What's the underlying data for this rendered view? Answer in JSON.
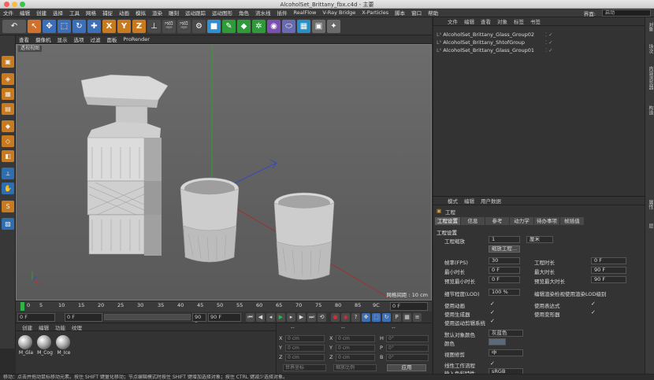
{
  "window": {
    "title": "AlcoholSet_Brittany_fbx.c4d - 主要"
  },
  "menubar": {
    "items": [
      "文件",
      "编辑",
      "创建",
      "选择",
      "工具",
      "网格",
      "捕捉",
      "动画",
      "模拟",
      "渲染",
      "雕刻",
      "运动跟踪",
      "运动图形",
      "角色",
      "流水线",
      "插件",
      "RealFlow",
      "V-Ray Bridge",
      "X-Particles",
      "脚本",
      "窗口",
      "帮助"
    ],
    "layout_label": "界面:",
    "layout_value": "启动"
  },
  "toolbar": {
    "axis_x": "X",
    "axis_y": "Y",
    "axis_z": "Z"
  },
  "viewport": {
    "menu": [
      "查看",
      "摄像机",
      "显示",
      "选项",
      "过滤",
      "面板",
      "ProRender"
    ],
    "label": "透视视图",
    "grid_label": "网格间距 : 10 cm"
  },
  "timeline": {
    "ticks": [
      "0",
      "5",
      "10",
      "15",
      "20",
      "25",
      "30",
      "35",
      "40",
      "45",
      "50",
      "55",
      "60",
      "65",
      "70",
      "75",
      "80",
      "85",
      "9C"
    ],
    "frame_display": "0 F"
  },
  "playbar": {
    "start": "0 F",
    "current": "0 F",
    "end_a": "90 F",
    "end_b": "90 F"
  },
  "materials": {
    "menu": [
      "创建",
      "编辑",
      "功能",
      "纹理"
    ],
    "items": [
      "M_Gla",
      "M_Cog",
      "M_Ice"
    ]
  },
  "coords": {
    "headers": [
      "--",
      "--",
      "--"
    ],
    "rows": [
      {
        "axis": "X",
        "pos": "0 cm",
        "axis2": "X",
        "size": "0 cm",
        "axis3": "H",
        "rot": "0°"
      },
      {
        "axis": "Y",
        "pos": "0 cm",
        "axis2": "Y",
        "size": "0 cm",
        "axis3": "P",
        "rot": "0°"
      },
      {
        "axis": "Z",
        "pos": "0 cm",
        "axis2": "Z",
        "size": "0 cm",
        "axis3": "B",
        "rot": "0°"
      }
    ],
    "mode1": "世界坐标",
    "mode2": "缩放比例",
    "apply": "应用"
  },
  "objects": {
    "menu": [
      "文件",
      "编辑",
      "查看",
      "对象",
      "标签",
      "书签"
    ],
    "items": [
      "AlcoholSet_Brittany_Glass_Group02",
      "AlcoholSet_Brittany_ShtofGroup",
      "AlcoholSet_Brittany_Glass_Group01"
    ]
  },
  "attributes": {
    "menu": [
      "模式",
      "编辑",
      "用户数据"
    ],
    "object_name": "工程",
    "tabs": [
      "工程设置",
      "信息",
      "参考",
      "动力学",
      "待办事项",
      "帧插值"
    ],
    "section": "工程设置",
    "scale_label": "工程缩放",
    "scale_value": "1",
    "scale_unit": "厘米",
    "scale_button": "缩放工程...",
    "fps_label": "帧率(FPS)",
    "fps_value": "30",
    "duration_label": "工程时长",
    "duration_value": "0 F",
    "min_time_label": "最小时长",
    "min_time_value": "0 F",
    "max_time_label": "最大时长",
    "max_time_value": "90 F",
    "preview_min_label": "预览最小时长",
    "preview_min_value": "0 F",
    "preview_max_label": "预览最大时长",
    "preview_max_value": "90 F",
    "lod_label": "细节程度(LOD)",
    "lod_value": "100 %",
    "lod_render_label": "编辑渲染检视使用渲染LOD级别",
    "use_anim": "使用动画",
    "use_expr": "使用表达式",
    "use_gen": "使用生成器",
    "use_deform": "使用变形器",
    "use_motion": "使用运动剪辑系统",
    "default_color_label": "默认对象颜色",
    "default_color_value": "灰蓝色",
    "color_label": "颜色",
    "view_clip_label": "视图修剪",
    "view_clip_value": "中",
    "linear_label": "线性工作流程",
    "input_color_label": "输入色彩特性",
    "input_color_value": "sRGB"
  },
  "right_tabs": [
    "对象",
    "场次",
    "内容浏览器",
    "构造",
    "属性",
    "层"
  ],
  "statusbar": {
    "text": "移动：点击并拖动鼠标移动元素。按住 SHIFT 键量化移动；节点编辑模式时按住 SHIFT 键增加选择对象；按住 CTRL 键减少选择对象。"
  }
}
